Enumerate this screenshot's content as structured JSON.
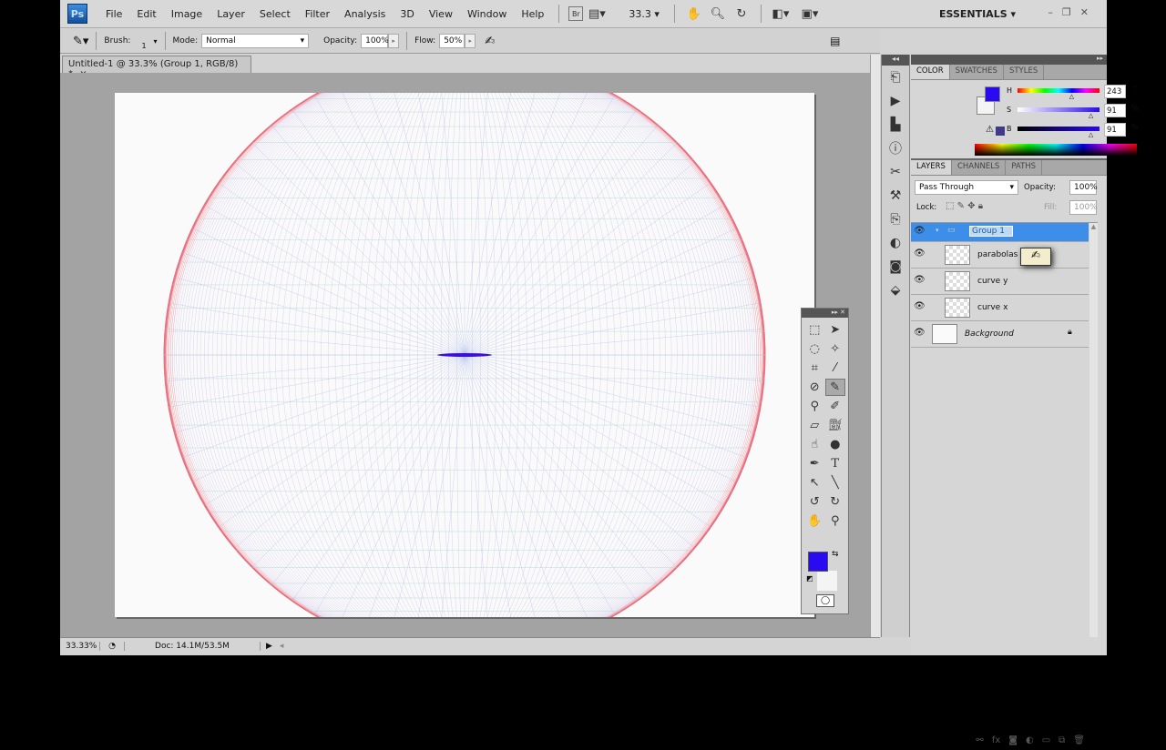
{
  "menu": {
    "logo": "Ps",
    "items": [
      "File",
      "Edit",
      "Image",
      "Layer",
      "Select",
      "Filter",
      "Analysis",
      "3D",
      "View",
      "Window",
      "Help"
    ],
    "bridge": "Br",
    "zoom": "33.3",
    "workspace": "ESSENTIALS"
  },
  "options": {
    "brush_label": "Brush:",
    "brush_size": "1",
    "mode_label": "Mode:",
    "mode": "Normal",
    "opacity_label": "Opacity:",
    "opacity": "100%",
    "flow_label": "Flow:",
    "flow": "50%"
  },
  "document": {
    "tab": "Untitled-1 @ 33.3% (Group 1, RGB/8) *",
    "close": "×"
  },
  "status": {
    "zoom": "33.33%",
    "doc": "Doc: 14.1M/53.5M"
  },
  "color_panel": {
    "tabs": [
      "COLOR",
      "SWATCHES",
      "STYLES"
    ],
    "h_label": "H",
    "s_label": "S",
    "b_label": "B",
    "h": "243",
    "s": "91",
    "b": "91",
    "h_unit": "°",
    "s_unit": "%",
    "b_unit": "%",
    "foreground": "#2a0af0",
    "background": "#f4f4f4",
    "h_fraction": 0.675,
    "s_fraction": 0.91,
    "b_fraction": 0.91
  },
  "layers_panel": {
    "tabs": [
      "LAYERS",
      "CHANNELS",
      "PATHS"
    ],
    "blend": "Pass Through",
    "opacity_label": "Opacity:",
    "opacity": "100%",
    "lock_label": "Lock:",
    "fill_label": "Fill:",
    "fill": "100%",
    "layers": [
      {
        "name": "Group 1",
        "type": "group",
        "selected": true
      },
      {
        "name": "parabolas z",
        "type": "layer"
      },
      {
        "name": "curve y",
        "type": "layer"
      },
      {
        "name": "curve x",
        "type": "layer"
      },
      {
        "name": "Background",
        "type": "background"
      }
    ]
  },
  "colors": {
    "selection": "#3d8ee8",
    "accent": "#2a0af0"
  }
}
